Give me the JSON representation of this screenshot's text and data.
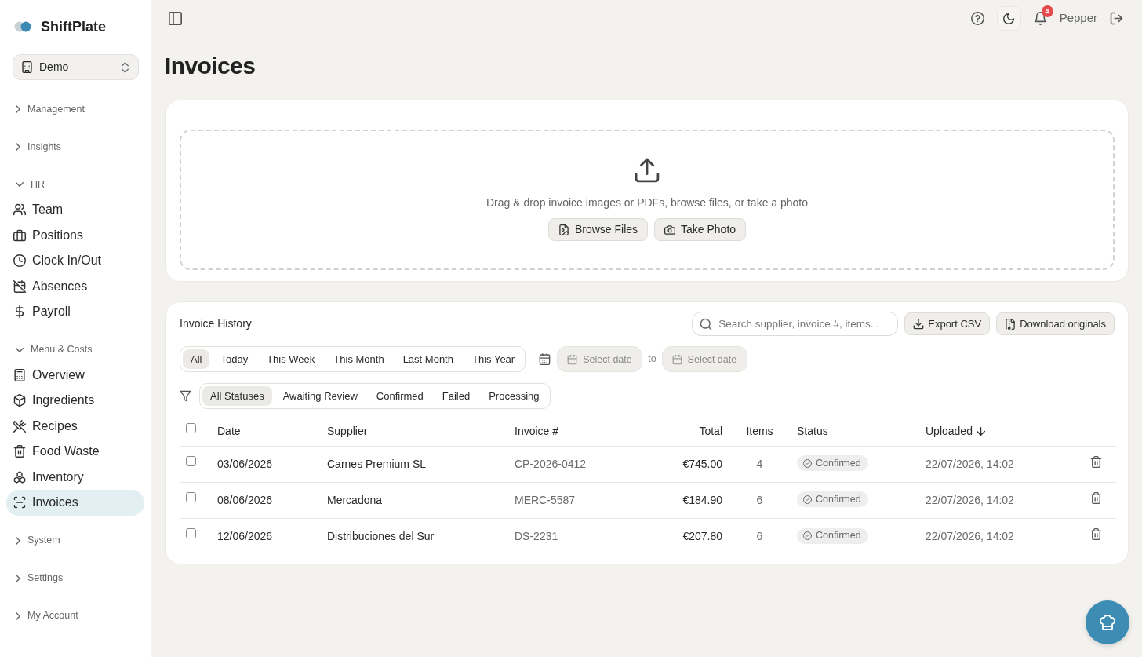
{
  "sidebar": {
    "brand": "ShiftPlate",
    "workspace": "Demo",
    "groups": [
      {
        "label": "Management",
        "expanded": false
      },
      {
        "label": "Insights",
        "expanded": false
      },
      {
        "label": "HR",
        "expanded": true,
        "items": [
          {
            "label": "Team",
            "selected": false
          },
          {
            "label": "Positions",
            "selected": false
          },
          {
            "label": "Clock In/Out",
            "selected": false
          },
          {
            "label": "Absences",
            "selected": false
          },
          {
            "label": "Payroll",
            "selected": false
          }
        ]
      },
      {
        "label": "Menu & Costs",
        "expanded": true,
        "items": [
          {
            "label": "Overview",
            "selected": false
          },
          {
            "label": "Ingredients",
            "selected": false
          },
          {
            "label": "Recipes",
            "selected": false
          },
          {
            "label": "Food Waste",
            "selected": false
          },
          {
            "label": "Inventory",
            "selected": false
          },
          {
            "label": "Invoices",
            "selected": true
          }
        ]
      },
      {
        "label": "System",
        "expanded": false
      },
      {
        "label": "Settings",
        "expanded": false
      },
      {
        "label": "My Account",
        "expanded": false
      }
    ]
  },
  "topbar": {
    "notification_count": "4",
    "user": "Pepper"
  },
  "page_title": "Invoices",
  "upload": {
    "hint": "Drag & drop invoice images or PDFs, browse files, or take a photo",
    "buttons": [
      "Browse Files",
      "Take Photo"
    ]
  },
  "history": {
    "title": "Invoice History",
    "search": {
      "placeholder": "Search supplier, invoice #, items..."
    },
    "actions": [
      "Export CSV",
      "Download originals"
    ],
    "periods": [
      {
        "label": "All",
        "selected": true
      },
      {
        "label": "Today",
        "selected": false
      },
      {
        "label": "This Week",
        "selected": false
      },
      {
        "label": "This Month",
        "selected": false
      },
      {
        "label": "Last Month",
        "selected": false
      },
      {
        "label": "This Year",
        "selected": false
      }
    ],
    "date_range": {
      "from_placeholder": "Select date",
      "separator": "to",
      "to_placeholder": "Select date"
    },
    "statuses": [
      {
        "label": "All Statuses",
        "selected": true
      },
      {
        "label": "Awaiting Review",
        "selected": false
      },
      {
        "label": "Confirmed",
        "selected": false
      },
      {
        "label": "Failed",
        "selected": false
      },
      {
        "label": "Processing",
        "selected": false
      }
    ],
    "table": {
      "select_all_checked": false,
      "columns": [
        {
          "label": "Date",
          "sorted": false
        },
        {
          "label": "Supplier",
          "sorted": false
        },
        {
          "label": "Invoice #",
          "sorted": false
        },
        {
          "label": "Total",
          "sorted": false
        },
        {
          "label": "Items",
          "sorted": false
        },
        {
          "label": "Status",
          "sorted": false
        },
        {
          "label": "Uploaded",
          "sorted": true
        }
      ],
      "rows": [
        {
          "checked": false,
          "date": "03/06/2026",
          "supplier": "Carnes Premium SL",
          "invoice": "CP-2026-0412",
          "total": "€745.00",
          "items": "4",
          "status": "Confirmed",
          "uploaded": "22/07/2026, 14:02"
        },
        {
          "checked": false,
          "date": "08/06/2026",
          "supplier": "Mercadona",
          "invoice": "MERC-5587",
          "total": "€184.90",
          "items": "6",
          "status": "Confirmed",
          "uploaded": "22/07/2026, 14:02"
        },
        {
          "checked": false,
          "date": "12/06/2026",
          "supplier": "Distribuciones del Sur",
          "invoice": "DS-2231",
          "total": "€207.80",
          "items": "6",
          "status": "Confirmed",
          "uploaded": "22/07/2026, 14:02"
        }
      ]
    }
  }
}
